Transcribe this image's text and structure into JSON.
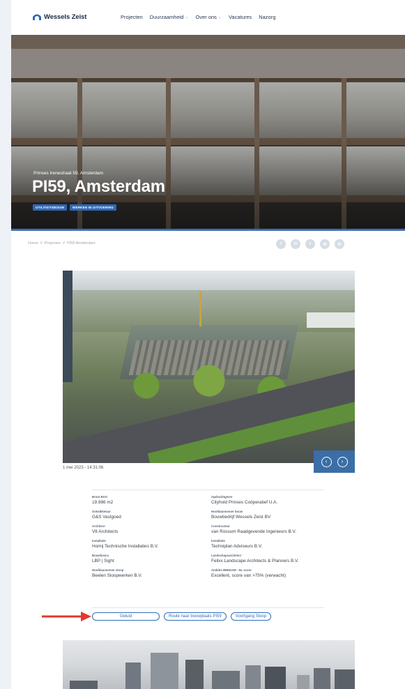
{
  "brand": {
    "name": "Wessels Zeist"
  },
  "nav": {
    "items": [
      {
        "label": "Projecten",
        "dropdown": false
      },
      {
        "label": "Duurzaamheid",
        "dropdown": true
      },
      {
        "label": "Over ons",
        "dropdown": true
      },
      {
        "label": "Vacatures",
        "dropdown": false
      },
      {
        "label": "Nazorg",
        "dropdown": false
      }
    ]
  },
  "hero": {
    "subtitle": "Prinses Irenestraat 59, Amsterdam",
    "title": "PI59, Amsterdam",
    "tags": [
      "UTILITEITSBOUW",
      "WERKEN IN UITVOERING"
    ]
  },
  "breadcrumb": {
    "items": [
      "Home",
      "Projecten",
      "PI59 Amsterdam"
    ],
    "separator": "//"
  },
  "social": [
    "facebook-icon",
    "linkedin-icon",
    "twitter-icon",
    "email-icon",
    "whatsapp-icon"
  ],
  "gallery": {
    "caption": "1 mei 2023 - 14:31:06",
    "prev_label": "‹",
    "next_label": "›"
  },
  "details": {
    "left": [
      {
        "label": "Bruto BVO",
        "value": "19.986 m2"
      },
      {
        "label": "Ontwikkelaar",
        "value": "G&S Vastgoed"
      },
      {
        "label": "Architect",
        "value": "V8 Architects"
      },
      {
        "label": "Installatie",
        "value": "Homij Technische Installaties B.V."
      },
      {
        "label": "Bouwfysica",
        "value": "LBP | Sight"
      },
      {
        "label": "Hoofdaannemer sloop",
        "value": "Beelen Sloopwerken B.V."
      }
    ],
    "right": [
      {
        "label": "Opdrachtgever",
        "value": "Cityhold Prinses Coöperatief U.A."
      },
      {
        "label": "Hoofdaannemer bouw",
        "value": "Bouwbedrijf Wessels Zeist BV"
      },
      {
        "label": "Constructeur",
        "value": "van Rossum Raadgevende Ingenieurs B.V."
      },
      {
        "label": "Installatie",
        "value": "Techniplan Adviseurs B.V."
      },
      {
        "label": "Landschapsarchitect",
        "value": "Felixx Landscape Architects & Planners B.V."
      },
      {
        "label": "Ambitie BREEAM - NL score",
        "value": "Excellent, score van >75% (verwacht)"
      }
    ]
  },
  "links": [
    "Geluid",
    "Route naar bouwplaats PI59",
    "Voortgang Sloop"
  ],
  "colors": {
    "accent": "#2e6db8",
    "pager": "#3b6ea7",
    "arrow": "#e03a2f"
  }
}
